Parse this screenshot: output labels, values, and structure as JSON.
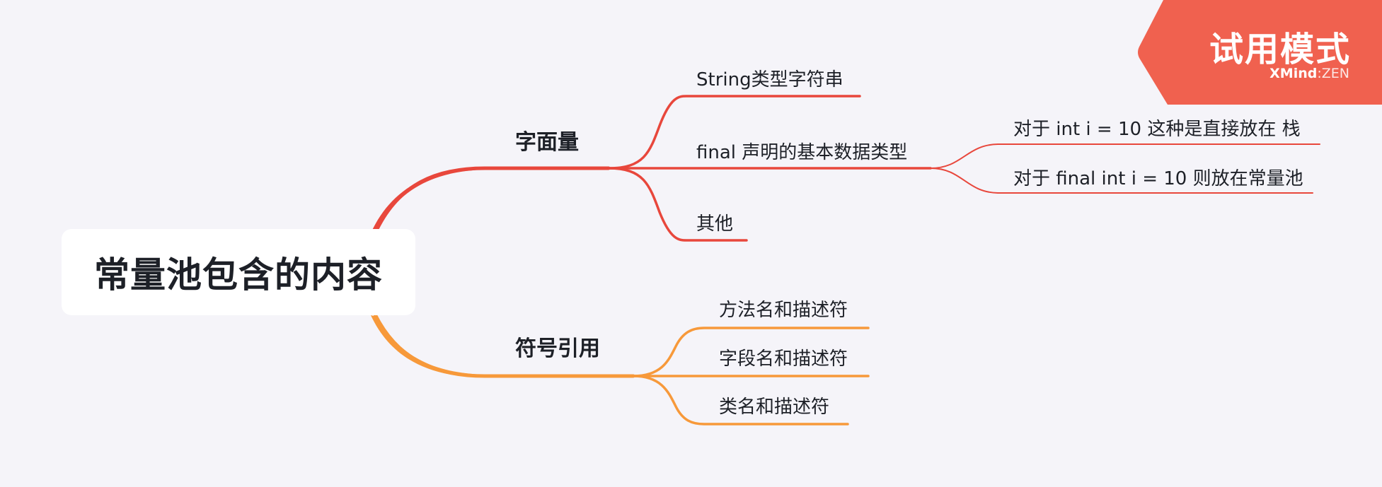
{
  "colors": {
    "background": "#f5f4f9",
    "branch_red": "#e8473c",
    "branch_orange": "#f7993a",
    "badge": "#f0614f"
  },
  "root": {
    "label": "常量池包含的内容"
  },
  "branches": [
    {
      "id": "literal",
      "label": "字面量",
      "color": "#e8473c",
      "children": [
        {
          "id": "string",
          "label": "String类型字符串",
          "children": []
        },
        {
          "id": "final",
          "label": "final 声明的基本数据类型",
          "children": [
            {
              "id": "int-stack",
              "label": "对于 int i  = 10 这种是直接放在 栈"
            },
            {
              "id": "final-pool",
              "label": "对于 final int i = 10 则放在常量池"
            }
          ]
        },
        {
          "id": "other",
          "label": "其他",
          "children": []
        }
      ]
    },
    {
      "id": "symbol",
      "label": "符号引用",
      "color": "#f7993a",
      "children": [
        {
          "id": "method",
          "label": "方法名和描述符",
          "children": []
        },
        {
          "id": "field",
          "label": "字段名和描述符",
          "children": []
        },
        {
          "id": "class",
          "label": "类名和描述符",
          "children": []
        }
      ]
    }
  ],
  "badge": {
    "title": "试用模式",
    "brand": "XMind",
    "brand_suffix": "ZEN",
    "separator": ":"
  }
}
